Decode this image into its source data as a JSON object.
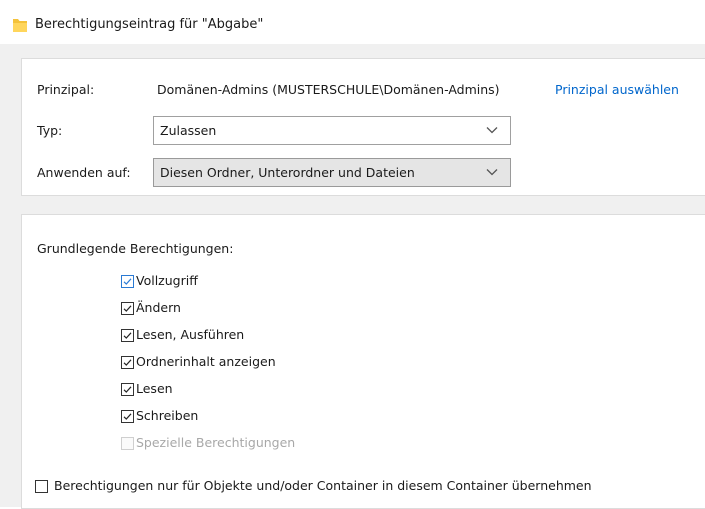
{
  "window": {
    "title": "Berechtigungseintrag für \"Abgabe\"",
    "icon": "folder-icon",
    "accent_color": "#0066cc"
  },
  "principal": {
    "label": "Prinzipal:",
    "value": "Domänen-Admins (MUSTERSCHULE\\Domänen-Admins)",
    "select_link": "Prinzipal auswählen"
  },
  "type": {
    "label": "Typ:",
    "value": "Zulassen"
  },
  "applies_to": {
    "label": "Anwenden auf:",
    "value": "Diesen Ordner, Unterordner und Dateien"
  },
  "permissions": {
    "heading": "Grundlegende Berechtigungen:",
    "items": [
      {
        "label": "Vollzugriff",
        "checked": true,
        "enabled": true,
        "focused": true
      },
      {
        "label": "Ändern",
        "checked": true,
        "enabled": true
      },
      {
        "label": "Lesen, Ausführen",
        "checked": true,
        "enabled": true
      },
      {
        "label": "Ordnerinhalt anzeigen",
        "checked": true,
        "enabled": true
      },
      {
        "label": "Lesen",
        "checked": true,
        "enabled": true
      },
      {
        "label": "Schreiben",
        "checked": true,
        "enabled": true
      },
      {
        "label": "Spezielle Berechtigungen",
        "checked": false,
        "enabled": false
      }
    ]
  },
  "inherit_option": {
    "label": "Berechtigungen nur für Objekte und/oder Container in diesem Container übernehmen",
    "checked": false
  }
}
